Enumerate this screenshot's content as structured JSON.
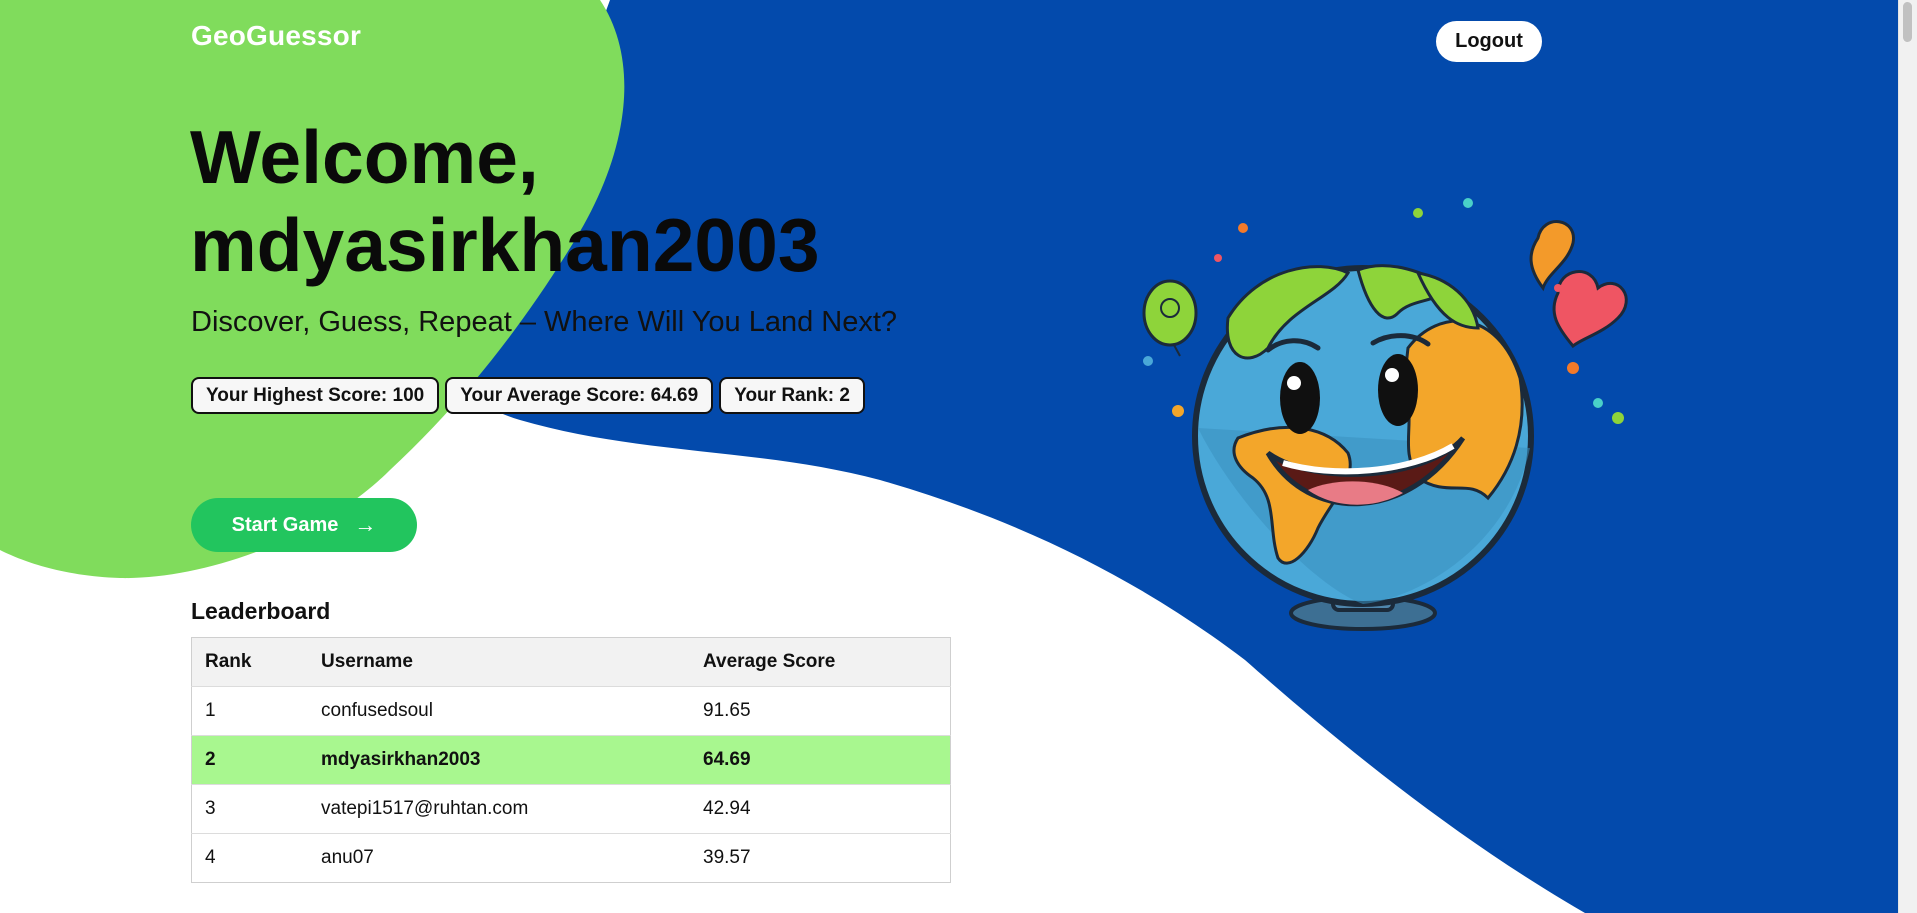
{
  "app": {
    "brand": "GeoGuessor",
    "logout_label": "Logout"
  },
  "hero": {
    "welcome": "Welcome, mdyasirkhan2003",
    "tagline": "Discover, Guess, Repeat – Where Will You Land Next?"
  },
  "stats": {
    "highest": "Your Highest Score: 100",
    "average": "Your Average Score: 64.69",
    "rank": "Your Rank: 2"
  },
  "start_button": {
    "label": "Start Game",
    "icon": "arrow-right-icon"
  },
  "leaderboard": {
    "title": "Leaderboard",
    "columns": [
      "Rank",
      "Username",
      "Average Score"
    ],
    "rows": [
      {
        "rank": "1",
        "username": "confusedsoul",
        "score": "91.65"
      },
      {
        "rank": "2",
        "username": "mdyasirkhan2003",
        "score": "64.69"
      },
      {
        "rank": "3",
        "username": "vatepi1517@ruhtan.com",
        "score": "42.94"
      },
      {
        "rank": "4",
        "username": "anu07",
        "score": "39.57"
      }
    ],
    "highlight_row": 2
  },
  "colors": {
    "blue_background": "#034aac",
    "green_blob": "#80dc5c",
    "start_button": "#22c55e",
    "highlight_row": "#a8f78f"
  },
  "illustration": {
    "icon": "smiling-globe-icon"
  }
}
